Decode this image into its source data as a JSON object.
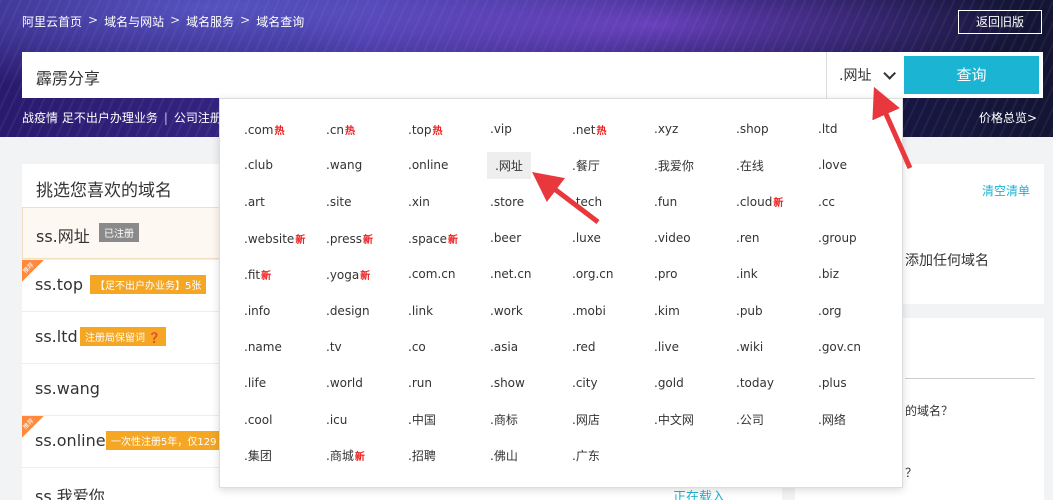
{
  "breadcrumb": [
    "阿里云首页",
    "域名与网站",
    "域名服务",
    "域名查询"
  ],
  "breadcrumb_sep": ">",
  "old_version_btn": "返回旧版",
  "search": {
    "value": "霹雳分享",
    "suffix": ".网址",
    "button": "查询"
  },
  "notice": {
    "part1": "战疫情 足不出户办理业务",
    "part2": "公司注册"
  },
  "price_link": "价格总览>",
  "left_panel": {
    "title": "挑选您喜欢的域名",
    "rows": [
      {
        "domain": "ss.网址",
        "tag": "已注册"
      },
      {
        "domain": "ss.top",
        "tag": "【足不出户办业务】5张",
        "ribbon": "推荐"
      },
      {
        "domain": "ss.ltd",
        "tag": "注册局保留词 ❓"
      },
      {
        "domain": "ss.wang"
      },
      {
        "domain": "ss.online",
        "tag": "一次性注册5年，仅129",
        "ribbon": "推荐"
      },
      {
        "domain": "ss.我爱你"
      }
    ],
    "loading": "正在载入"
  },
  "right_panel": {
    "clear": "清空清单",
    "empty": "添加任何域名",
    "q1": "的域名？",
    "q2": "？"
  },
  "suffix_dropdown": {
    "hot_label": "热",
    "new_label": "新",
    "items": [
      {
        "t": ".com",
        "b": "hot"
      },
      {
        "t": ".cn",
        "b": "hot"
      },
      {
        "t": ".top",
        "b": "hot"
      },
      {
        "t": ".vip"
      },
      {
        "t": ".net",
        "b": "hot"
      },
      {
        "t": ".xyz"
      },
      {
        "t": ".shop"
      },
      {
        "t": ".ltd"
      },
      {
        "t": ".club"
      },
      {
        "t": ".wang"
      },
      {
        "t": ".online"
      },
      {
        "t": ".网址",
        "active": true
      },
      {
        "t": ".餐厅"
      },
      {
        "t": ".我爱你"
      },
      {
        "t": ".在线"
      },
      {
        "t": ".love"
      },
      {
        "t": ".art"
      },
      {
        "t": ".site"
      },
      {
        "t": ".xin"
      },
      {
        "t": ".store"
      },
      {
        "t": ".tech"
      },
      {
        "t": ".fun"
      },
      {
        "t": ".cloud",
        "b": "new"
      },
      {
        "t": ".cc"
      },
      {
        "t": ".website",
        "b": "new"
      },
      {
        "t": ".press",
        "b": "new"
      },
      {
        "t": ".space",
        "b": "new"
      },
      {
        "t": ".beer"
      },
      {
        "t": ".luxe"
      },
      {
        "t": ".video"
      },
      {
        "t": ".ren"
      },
      {
        "t": ".group"
      },
      {
        "t": ".fit",
        "b": "new"
      },
      {
        "t": ".yoga",
        "b": "new"
      },
      {
        "t": ".com.cn"
      },
      {
        "t": ".net.cn"
      },
      {
        "t": ".org.cn"
      },
      {
        "t": ".pro"
      },
      {
        "t": ".ink"
      },
      {
        "t": ".biz"
      },
      {
        "t": ".info"
      },
      {
        "t": ".design"
      },
      {
        "t": ".link"
      },
      {
        "t": ".work"
      },
      {
        "t": ".mobi"
      },
      {
        "t": ".kim"
      },
      {
        "t": ".pub"
      },
      {
        "t": ".org"
      },
      {
        "t": ".name"
      },
      {
        "t": ".tv"
      },
      {
        "t": ".co"
      },
      {
        "t": ".asia"
      },
      {
        "t": ".red"
      },
      {
        "t": ".live"
      },
      {
        "t": ".wiki"
      },
      {
        "t": ".gov.cn"
      },
      {
        "t": ".life"
      },
      {
        "t": ".world"
      },
      {
        "t": ".run"
      },
      {
        "t": ".show"
      },
      {
        "t": ".city"
      },
      {
        "t": ".gold"
      },
      {
        "t": ".today"
      },
      {
        "t": ".plus"
      },
      {
        "t": ".cool"
      },
      {
        "t": ".icu"
      },
      {
        "t": ".中国"
      },
      {
        "t": ".商标"
      },
      {
        "t": ".网店"
      },
      {
        "t": ".中文网"
      },
      {
        "t": ".公司"
      },
      {
        "t": ".网络"
      },
      {
        "t": ".集团"
      },
      {
        "t": ".商城",
        "b": "new"
      },
      {
        "t": ".招聘"
      },
      {
        "t": ".佛山"
      },
      {
        "t": ".广东"
      }
    ]
  },
  "colors": {
    "accent": "#1bb4d2",
    "hot": "#ee2222",
    "arrow": "#e8383d"
  }
}
